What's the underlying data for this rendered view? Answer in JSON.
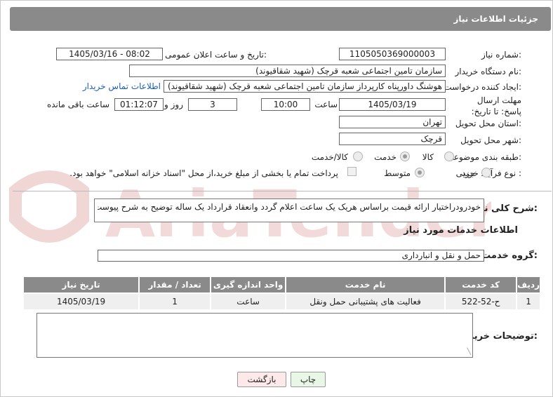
{
  "header": {
    "title": "جزئیات اطلاعات نیاز"
  },
  "labels": {
    "need_number": "شماره نیاز:",
    "announce_datetime": "تاریخ و ساعت اعلان عمومی:",
    "buyer_org": "نام دستگاه خریدار:",
    "requester": "ایجاد کننده درخواست:",
    "deadline": "مهلت ارسال پاسخ: تا تاریخ:",
    "hour": "ساعت",
    "day_and": "روز و",
    "remaining": "ساعت باقی مانده",
    "province": "استان محل تحویل:",
    "city": "شهر محل تحویل:",
    "category": "طبقه بندی موضوعی:",
    "purchase_type": "نوع فرآیند خرید :",
    "description": "شرح کلی نیاز:",
    "services_info": "اطلاعات خدمات مورد نیاز",
    "service_group": "گروه خدمت:",
    "buyer_notes": "توضیحات خریدار:"
  },
  "values": {
    "need_number": "1105050369000003",
    "announce_datetime": "1405/03/16 - 08:02",
    "buyer_org": "سازمان تامین اجتماعی شعبه قرچک (شهید شقاقیوند)",
    "requester": "هوشنگ  داورپناه کارپرداز سازمان تامین اجتماعی شعبه قرچک (شهید شقاقیوند)",
    "contact_link": "اطلاعات تماس خریدار",
    "deadline_date": "1405/03/19",
    "deadline_time": "10:00",
    "days": "3",
    "remaining_time": "01:12:07",
    "province": "تهران",
    "city": "قرچک",
    "description": "خودرودراختیار ارائه قیمت براساس هریک یک ساعت اعلام گردد وانعقاد قرارداد یک ساله توضیح به شرح پیوست",
    "service_group": "حمل و نقل و انبارداری",
    "buyer_notes": ""
  },
  "category_options": [
    {
      "label": "کالا",
      "selected": false
    },
    {
      "label": "خدمت",
      "selected": true
    },
    {
      "label": "کالا/خدمت",
      "selected": false
    }
  ],
  "purchase_options": [
    {
      "label": "جزیی",
      "selected": false
    },
    {
      "label": "متوسط",
      "selected": true
    }
  ],
  "payment_note": "پرداخت تمام یا بخشی از مبلغ خرید،از محل \"اسناد خزانه اسلامی\" خواهد بود.",
  "services_table": {
    "headers": [
      "ردیف",
      "کد خدمت",
      "نام خدمت",
      "واحد اندازه گیری",
      "تعداد / مقدار",
      "تاریخ نیاز"
    ],
    "rows": [
      [
        "1",
        "ح-52-522",
        "فعالیت های پشتیبانی حمل ونقل",
        "ساعت",
        "1",
        "1405/03/19"
      ]
    ]
  },
  "buttons": {
    "print": "چاپ",
    "back": "بازگشت"
  },
  "watermark": "AriaTender.net",
  "colors": {
    "header_bg": "#8a8a8a",
    "link": "#1a5fb4",
    "back_button_bg": "#fde9e9",
    "print_button_bg": "#e9f8e6",
    "watermark": "#f1d6d6"
  }
}
